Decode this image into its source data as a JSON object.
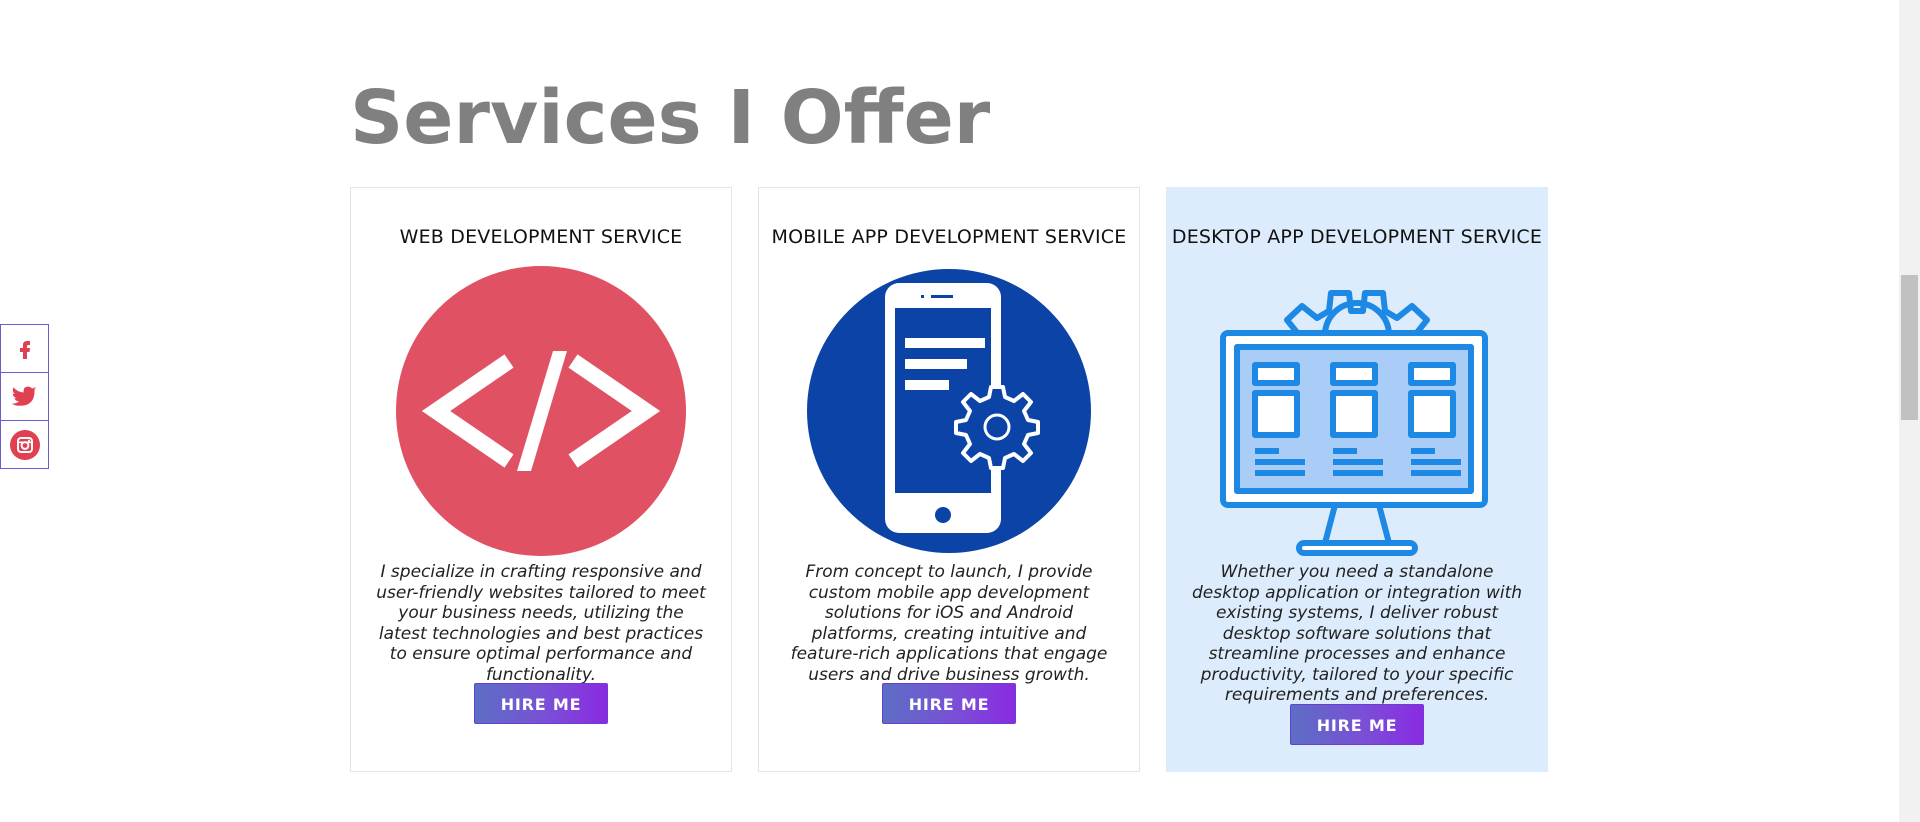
{
  "section": {
    "title": "Services I Offer"
  },
  "cards": [
    {
      "title": "WEB DEVELOPMENT SERVICE",
      "icon": "code-icon",
      "description": "I specialize in crafting responsive and user-friendly websites tailored to meet your business needs, utilizing the latest technologies and best practices to ensure optimal performance and functionality.",
      "button_label": "HIRE ME",
      "accent": "#e05263"
    },
    {
      "title": "MOBILE APP DEVELOPMENT SERVICE",
      "icon": "mobile-app-icon",
      "description": "From concept to launch, I provide custom mobile app development solutions for iOS and Android platforms, creating intuitive and feature-rich applications that engage users and drive business growth.",
      "button_label": "HIRE ME",
      "accent": "#0b44a6"
    },
    {
      "title": "DESKTOP APP DEVELOPMENT SERVICE",
      "icon": "desktop-app-icon",
      "description": "Whether you need a standalone desktop application or integration with existing systems, I deliver robust desktop software solutions that streamline processes and enhance productivity, tailored to your specific requirements and preferences.",
      "button_label": "HIRE ME",
      "accent": "#1e88e5",
      "highlighted": true
    }
  ],
  "social": [
    {
      "name": "facebook-icon",
      "color": "#e04050"
    },
    {
      "name": "twitter-icon",
      "color": "#e04050"
    },
    {
      "name": "instagram-icon",
      "color": "#e04050"
    }
  ],
  "colors": {
    "title": "#808080",
    "highlight_bg": "#dcecfc",
    "button_gradient_start": "#5c6fc4",
    "button_gradient_end": "#8a2be2"
  }
}
